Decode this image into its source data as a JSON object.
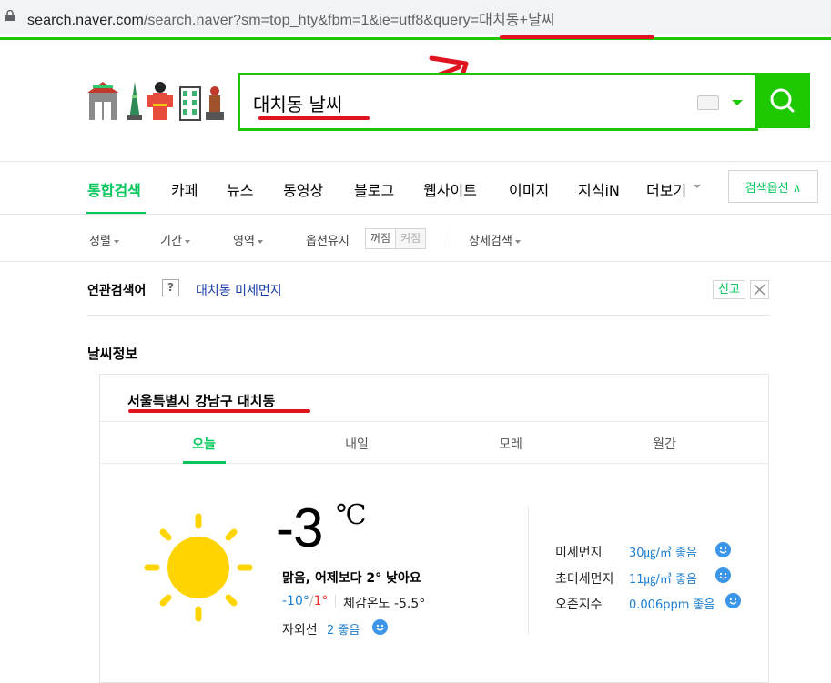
{
  "browser": {
    "url_prefix": "search.naver.com",
    "url_rest": "/search.naver?sm=top_hty&fbm=1&ie=utf8&query=대치동+날씨"
  },
  "header": {
    "search_query": "대치동 날씨",
    "search_button_icon": "search-icon",
    "keyboard_icon": "keyboard-icon"
  },
  "tabs": [
    {
      "label": "통합검색"
    },
    {
      "label": "카페"
    },
    {
      "label": "뉴스"
    },
    {
      "label": "동영상"
    },
    {
      "label": "블로그"
    },
    {
      "label": "웹사이트"
    },
    {
      "label": "이미지"
    },
    {
      "label": "지식iN"
    },
    {
      "label": "더보기"
    }
  ],
  "search_options_label": "검색옵션 ∧",
  "filters": {
    "sort": "정렬",
    "period": "기간",
    "area": "영역",
    "keep_options": "옵션유지",
    "on": "꺼짐",
    "off": "켜짐",
    "detail": "상세검색"
  },
  "related": {
    "label": "연관검색어",
    "help": "?",
    "item": "대치동 미세먼지",
    "report": "신고"
  },
  "weather": {
    "section_title": "날씨정보",
    "location": "서울특별시 강남구 대치동",
    "tabs": [
      "오늘",
      "내일",
      "모레",
      "월간"
    ],
    "temperature": "-3",
    "unit": "℃",
    "description": "맑음, 어제보다 2° 낮아요",
    "min": "-10°",
    "slash": "/",
    "max": "1°",
    "feels_like": "체감온도 -5.5°",
    "uv_label": "자외선",
    "uv_value": "2 좋음",
    "air_quality": [
      {
        "label": "미세먼지",
        "value": "30㎍/㎥ 좋음"
      },
      {
        "label": "초미세먼지",
        "value": "11㎍/㎥ 좋음"
      },
      {
        "label": "오존지수",
        "value": "0.006ppm 좋음"
      }
    ]
  },
  "colors": {
    "naver_green": "#03c75a",
    "annotation_red": "#e0141e",
    "sun_yellow": "#ffd400",
    "link_blue": "#1e7fd1"
  }
}
